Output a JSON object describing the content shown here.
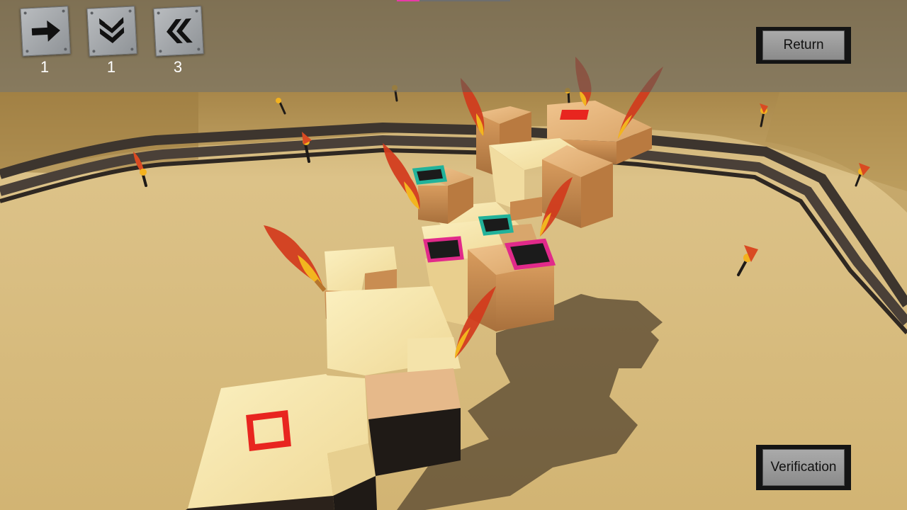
{
  "moves": [
    {
      "icon": "arrow-right-icon",
      "count": "1"
    },
    {
      "icon": "double-chevron-down-icon",
      "count": "1"
    },
    {
      "icon": "double-chevron-left-icon",
      "count": "3"
    }
  ],
  "buttons": {
    "return_label": "Return",
    "verification_label": "Verification"
  },
  "progress": {
    "fraction": 0.2
  },
  "colors": {
    "hud_bar": "#5f5c56",
    "sand": "#d9bd80",
    "rail": "#433c35",
    "block_light": "#f3e1a3",
    "block_brick": "#d79b5c",
    "target_red": "#e8251f",
    "target_magenta": "#e12a8a",
    "target_teal": "#22b29a",
    "flame_red": "#d2391c",
    "flame_yellow": "#f2b51f"
  }
}
